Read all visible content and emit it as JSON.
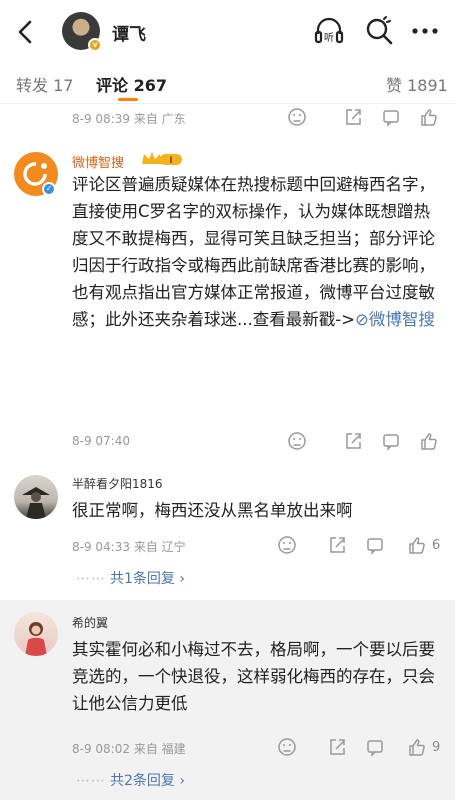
{
  "header": {
    "user_name": "谭飞",
    "icons": [
      "back-arrow-icon",
      "listen-headphone-icon",
      "search-icon",
      "more-icon"
    ],
    "listen_label": "听"
  },
  "tabs": {
    "repost": "转发 17",
    "comments": "评论 267",
    "likes": "赞 1891",
    "accent_color": "#ff8200"
  },
  "prev_comment": {
    "date": "8-9 08:39",
    "location": "来自 广东"
  },
  "comments": [
    {
      "user": "微博智搜",
      "badge": "I",
      "text": "评论区普遍质疑媒体在热搜标题中回避梅西名字，直接使用C罗名字的双标操作，认为媒体既想蹭热度又不敢提梅西，显得可笑且缺乏担当；部分评论归因于行政指令或梅西此前缺席香港比赛的影响，也有观点指出官方媒体正常报道，微博平台过度敏感；此外还夹杂着球迷...查看最新戳->",
      "link_text": "微博智搜",
      "date": "8-9 07:40",
      "location": "",
      "likes": ""
    },
    {
      "user": "半醉看夕阳1816",
      "text": "很正常啊，梅西还没从黑名单放出来啊",
      "date": "8-9 04:33",
      "location": "来自 辽宁",
      "likes": "6",
      "replies": "共1条回复 ›"
    },
    {
      "user": "希的翼",
      "text": "其实霍何必和小梅过不去，格局啊，一个要以后要竞选的，一个快退役，这样弱化梅西的存在，只会让他公信力更低",
      "date": "8-9 08:02",
      "location": "来自 福建",
      "likes": "9",
      "replies": "共2条回复 ›"
    }
  ]
}
